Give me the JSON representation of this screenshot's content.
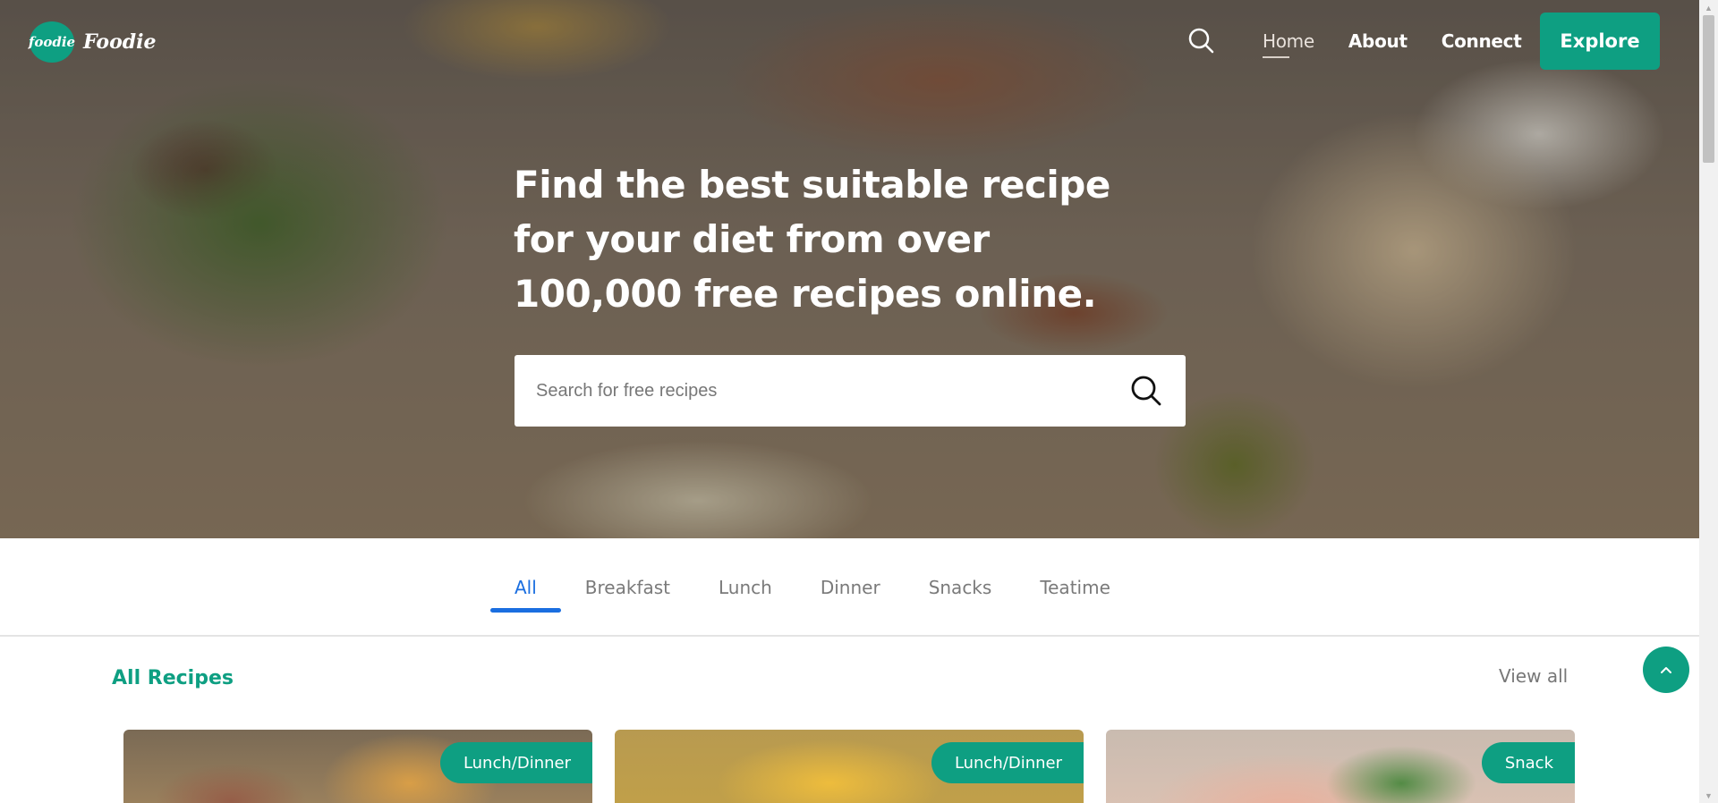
{
  "brand": {
    "logo_text": "foodie",
    "name": "Foodie"
  },
  "nav": {
    "links": [
      {
        "label": "Home"
      },
      {
        "label": "About"
      },
      {
        "label": "Connect"
      }
    ],
    "explore_label": "Explore"
  },
  "hero": {
    "headline": "Find the best suitable recipe for your diet from over 100,000 free recipes online.",
    "search_placeholder": "Search for free recipes"
  },
  "tabs": [
    {
      "label": "All",
      "active": true
    },
    {
      "label": "Breakfast"
    },
    {
      "label": "Lunch"
    },
    {
      "label": "Dinner"
    },
    {
      "label": "Snacks"
    },
    {
      "label": "Teatime"
    }
  ],
  "section": {
    "title": "All Recipes",
    "view_all": "View all"
  },
  "cards": [
    {
      "tag": "Lunch/Dinner"
    },
    {
      "tag": "Lunch/Dinner"
    },
    {
      "tag": "Snack"
    }
  ],
  "colors": {
    "accent": "#0e9f82",
    "tab_active": "#1a6ee0"
  }
}
